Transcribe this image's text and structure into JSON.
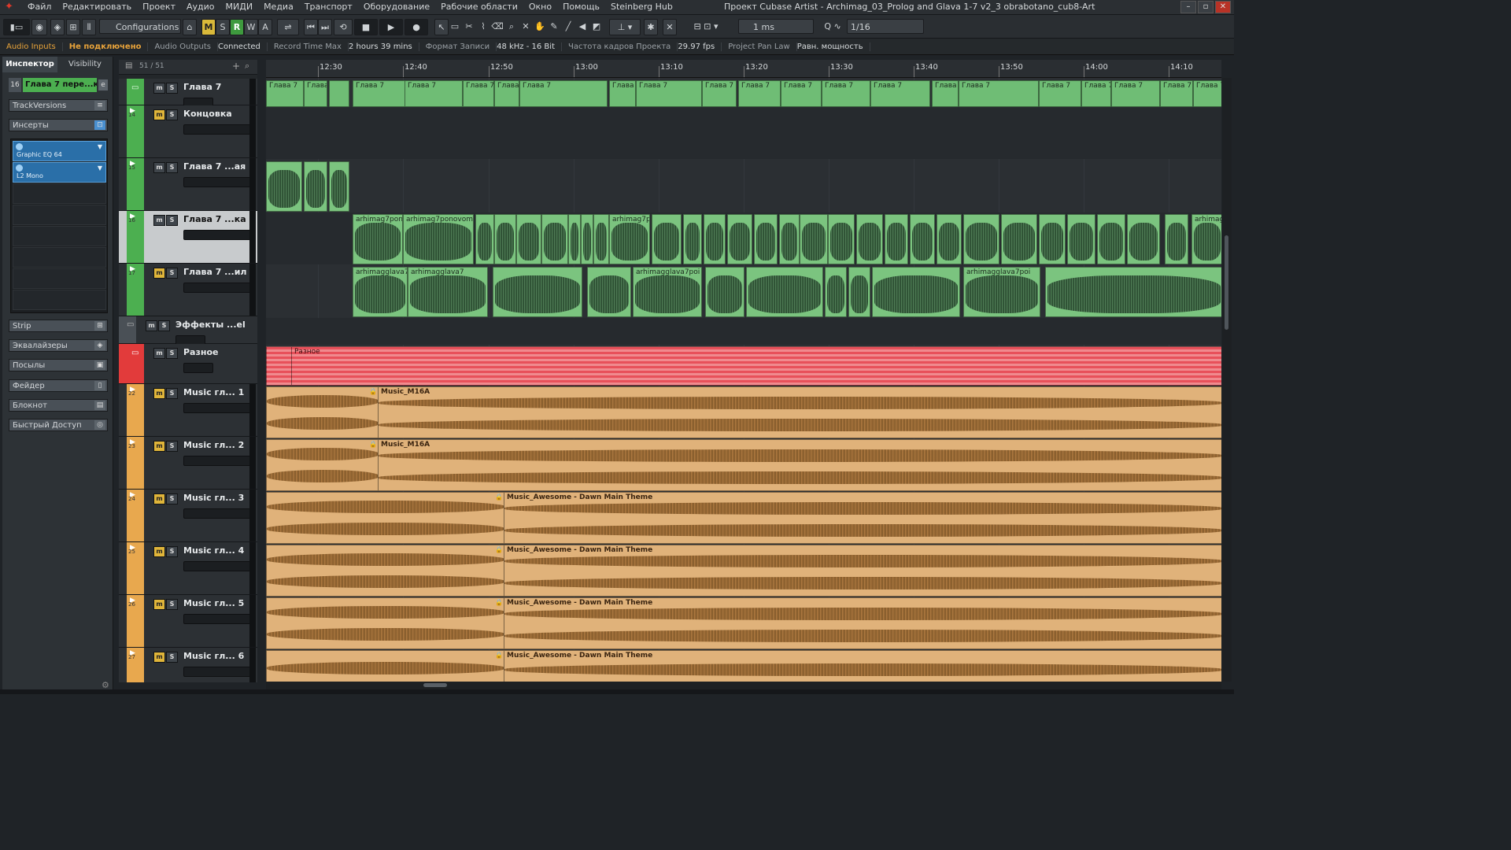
{
  "app": {
    "window_title": "Проект Cubase Artist - Archimag_03_Prolog and Glava 1-7 v2_3 obrabotano_cub8-Art",
    "menu": [
      "Файл",
      "Редактировать",
      "Проект",
      "Аудио",
      "МИДИ",
      "Медиа",
      "Транспорт",
      "Оборудование",
      "Рабочие области",
      "Окно",
      "Помощь",
      "Steinberg Hub"
    ]
  },
  "toolbar": {
    "configurations_label": "Configurations",
    "mode_m": "M",
    "mode_s": "S",
    "mode_r": "R",
    "mode_w": "W",
    "mode_a": "A",
    "nudge_value": "1 ms",
    "quantize_value": "1/16"
  },
  "statusline": {
    "audio_inputs_label": "Audio Inputs",
    "audio_inputs_value": "Не подключено",
    "audio_outputs_label": "Audio Outputs",
    "audio_outputs_value": "Connected",
    "record_time_label": "Record Time Max",
    "record_time_value": "2 hours 39 mins",
    "record_format_label": "Формат Записи",
    "record_format_value": "48 kHz - 16 Bit",
    "frame_rate_label": "Частота кадров Проекта",
    "frame_rate_value": "29.97 fps",
    "pan_law_label": "Project Pan Law",
    "pan_law_value": "Равн. мощность"
  },
  "inspector": {
    "tab_inspector": "Инспектор",
    "tab_visibility": "Visibility",
    "track_number": "16",
    "track_name": "Глава 7 пере...ка",
    "sections": [
      "TrackVersions",
      "Инсерты",
      "Strip",
      "Эквалайзеры",
      "Посылы",
      "Фейдер",
      "Блокнот",
      "Быстрый Доступ"
    ],
    "inserts": [
      "Graphic EQ 64",
      "L2 Mono"
    ]
  },
  "tracklist": {
    "count": "51 / 51",
    "tracks": [
      {
        "num": "",
        "name": "Глава 7"
      },
      {
        "num": "14",
        "name": "Концовка"
      },
      {
        "num": "15",
        "name": "Глава 7 ...ая"
      },
      {
        "num": "16",
        "name": "Глава 7 ...ка"
      },
      {
        "num": "17",
        "name": "Глава 7 ...ил"
      },
      {
        "num": "",
        "name": "Эффекты ...el"
      },
      {
        "num": "",
        "name": "Разное"
      },
      {
        "num": "22",
        "name": "Music гл... 1"
      },
      {
        "num": "23",
        "name": "Music гл... 2"
      },
      {
        "num": "24",
        "name": "Music гл... 3"
      },
      {
        "num": "25",
        "name": "Music гл... 4"
      },
      {
        "num": "26",
        "name": "Music гл... 5"
      },
      {
        "num": "27",
        "name": "Music гл... 6"
      }
    ]
  },
  "ruler": {
    "ticks": [
      "12:30",
      "12:40",
      "12:50",
      "13:00",
      "13:10",
      "13:20",
      "13:30",
      "13:40",
      "13:50",
      "14:00",
      "14:10"
    ]
  },
  "clips": {
    "folder_label": "Глава 7",
    "clip_16_a": "arhimag7pon",
    "clip_16_b": "arhimag7ponovomi",
    "clip_16_c": "arhimag7p",
    "clip_16_d": "arhimag",
    "clip_17_a": "arhimagglava7",
    "clip_17_b": "arhimagglava7",
    "clip_17_c": "arhimagglava7poi",
    "clip_17_d": "arhimagglava7poi",
    "misc_label": "Разное",
    "music_m16a": "Music_M16A",
    "music_awesome": "Music_Awesome - Dawn Main Theme"
  },
  "colors": {
    "green_clip": "#7bc47f",
    "orange_clip": "#e0b27a",
    "red_clip": "#e8505a",
    "accent_yellow": "#d9b93a"
  }
}
